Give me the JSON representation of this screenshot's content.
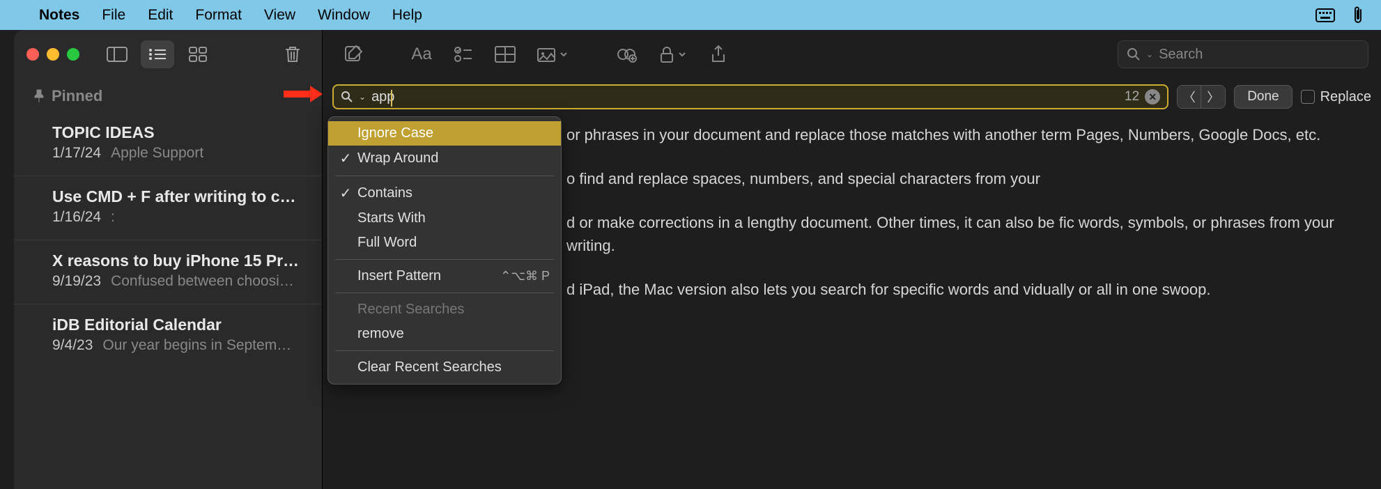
{
  "menubar": {
    "app": "Notes",
    "items": [
      "File",
      "Edit",
      "Format",
      "View",
      "Window",
      "Help"
    ]
  },
  "sidebar": {
    "pinned_label": "Pinned",
    "notes": [
      {
        "title": "TOPIC IDEAS",
        "date": "1/17/24",
        "preview": "Apple Support"
      },
      {
        "title": "Use CMD + F after writing to c…",
        "date": "1/16/24",
        "preview": ":"
      },
      {
        "title": "X reasons to buy iPhone 15 Pr…",
        "date": "9/19/23",
        "preview": "Confused between choosi…"
      },
      {
        "title": "iDB Editorial Calendar",
        "date": "9/4/23",
        "preview": "Our year begins in Septem…"
      }
    ]
  },
  "toolbar": {
    "search_placeholder": "Search"
  },
  "find": {
    "value": "app",
    "count": "12",
    "done": "Done",
    "replace_label": "Replace",
    "dropdown": {
      "ignore_case": "Ignore Case",
      "wrap_around": "Wrap Around",
      "contains": "Contains",
      "starts_with": "Starts With",
      "full_word": "Full Word",
      "insert_pattern": "Insert Pattern",
      "insert_pattern_shortcut": "⌃⌥⌘ P",
      "recent_header": "Recent Searches",
      "recent_0": "remove",
      "clear_recent": "Clear Recent Searches"
    }
  },
  "body": {
    "p1": "or phrases in your document and replace those matches with another term Pages, Numbers, Google Docs, etc.",
    "p2": "o find and replace spaces, numbers, and special characters from your",
    "p3": "d or make corrections in a lengthy document. Other times, it can also be fic words, symbols, or phrases from your writing.",
    "p4": "d iPad, the Mac version also lets you search for specific words and vidually or all in one swoop."
  }
}
